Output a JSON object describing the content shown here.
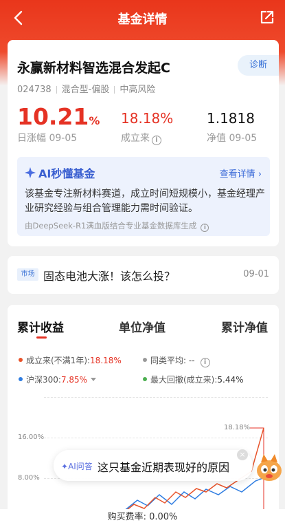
{
  "header": {
    "title": "基金详情",
    "back_icon": "chevron-left-icon",
    "share_icon": "share-icon",
    "bg": "#e9361b"
  },
  "fund": {
    "name": "永赢新材料智选混合发起C",
    "diagnose": "诊断",
    "code": "024738",
    "type": "混合型-偏股",
    "risk": "中高风险"
  },
  "stats": {
    "daily_value": "10.21",
    "daily_unit": "%",
    "daily_label": "日涨幅 09-05",
    "since_value": "18.18%",
    "since_label": "成立来",
    "nav_value": "1.1818",
    "nav_label": "净值 09-05"
  },
  "ai_card": {
    "title": "AI秒懂基金",
    "more": "查看详情",
    "body": "该基金专注新材料赛道，成立时间短规模小，基金经理产业研究经验与组合管理能力需时间验证。",
    "source": "由DeepSeek-R1满血版结合专业基金数据库生成"
  },
  "news": {
    "tag": "市场",
    "text": "固态电池大涨！该怎么投？",
    "date": "09-01"
  },
  "tabs": [
    "累计收益",
    "单位净值",
    "累计净值"
  ],
  "legend": {
    "fund_label": "成立来(不满1年):",
    "fund_value": "18.18%",
    "peer_label": "同类平均:",
    "peer_value": "--",
    "index_label": "沪深300:",
    "index_value": "7.85%",
    "drawdown_label": "最大回撤(成立来):",
    "drawdown_value": "5.44%"
  },
  "chart_data": {
    "type": "line",
    "y_ticks": [
      "16.00%",
      "8.00%"
    ],
    "end_label": "18.18%",
    "series": [
      {
        "name": "成立来",
        "color": "#e53224"
      },
      {
        "name": "沪深300",
        "color": "#2f7de1"
      }
    ]
  },
  "ai_bubble": {
    "tag": "AI问答",
    "question": "这只基金近期表现好的原因"
  },
  "footer": {
    "fee": "购买费率: 0.00%"
  },
  "colors": {
    "accent": "#e53224",
    "blue": "#2f7de1"
  }
}
